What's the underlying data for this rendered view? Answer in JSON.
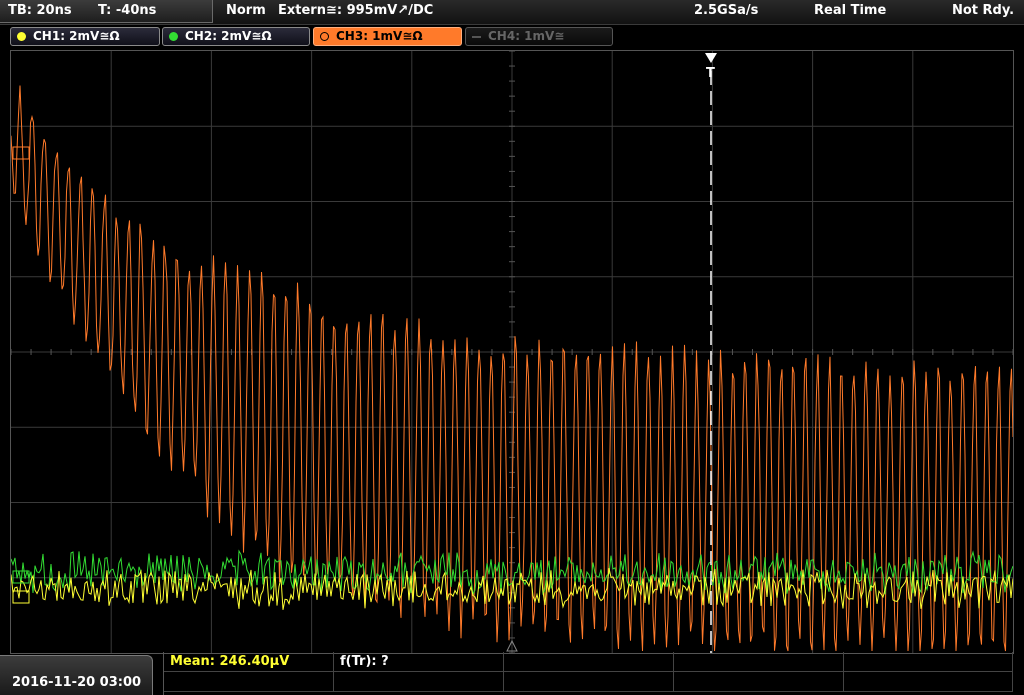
{
  "status": {
    "timebase": "TB: 20ns",
    "trigger_offset": "T: -40ns",
    "mode": "Norm",
    "trigger_source": "Extern≅: 995mV↗/DC",
    "sample_rate": "2.5GSa/s",
    "acquisition": "Real Time",
    "run_state": "Not Rdy."
  },
  "channels": [
    {
      "label": "CH1: 2mV≅Ω",
      "color": "#ffff33",
      "state": "on"
    },
    {
      "label": "CH2: 2mV≅Ω",
      "color": "#33dd33",
      "state": "on"
    },
    {
      "label": "CH3: 1mV≅Ω",
      "color": "#ff7a2a",
      "state": "selected"
    },
    {
      "label": "CH4: 1mV≅",
      "color": "#777777",
      "state": "off"
    }
  ],
  "trigger_marker": "T",
  "measurements": {
    "mean": "Mean: 246.40µV",
    "rise_freq": "f(Tr): ?"
  },
  "datetime": "2016-11-20 03:00",
  "colors": {
    "ch1": "#ffff33",
    "ch2": "#33dd33",
    "ch3": "#ff7a2a",
    "grid": "#3a3a3a",
    "trigger_line": "#ffffff"
  }
}
